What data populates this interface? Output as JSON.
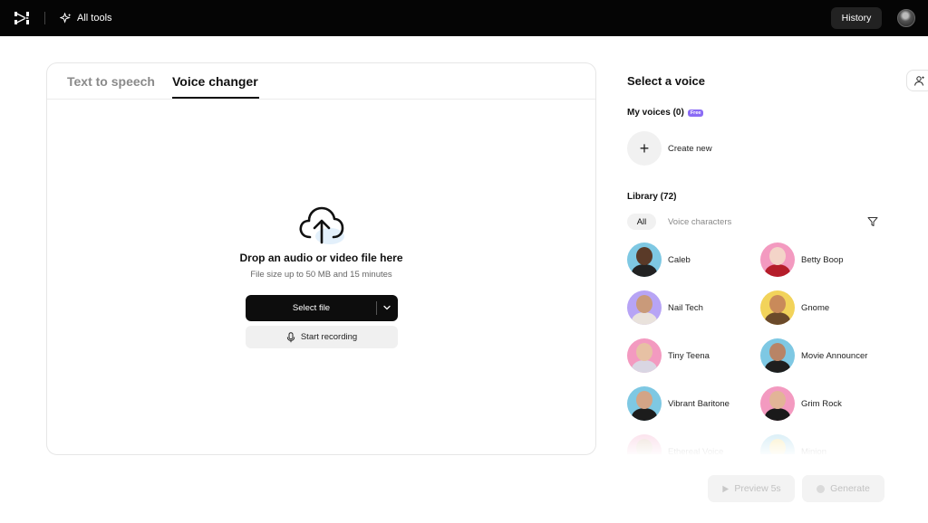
{
  "topbar": {
    "logo_icon": "capcut-logo-icon",
    "all_tools_label": "All tools",
    "all_tools_icon": "sparkle-icon",
    "history_label": "History"
  },
  "tabs": [
    {
      "label": "Text to speech",
      "active": false
    },
    {
      "label": "Voice changer",
      "active": true
    }
  ],
  "upload": {
    "icon": "cloud-upload-icon",
    "title": "Drop an audio or video file here",
    "subtitle": "File size up to 50 MB and 15 minutes",
    "select_label": "Select file",
    "record_label": "Start recording"
  },
  "voices": {
    "title": "Select a voice",
    "my_voices_label": "My voices (0)",
    "free_badge": "Free",
    "create_label": "Create new",
    "library_label": "Library (72)",
    "filter_all": "All",
    "filter_chars": "Voice characters",
    "items": [
      {
        "name": "Caleb",
        "bg": "#7ec8e3",
        "skin": "#5a3a28",
        "shirt": "#222"
      },
      {
        "name": "Betty Boop",
        "bg": "#f39ac0",
        "skin": "#f3d4c8",
        "shirt": "#b51d2a"
      },
      {
        "name": "Nail Tech",
        "bg": "#b7a4f5",
        "skin": "#c99a7a",
        "shirt": "#e9e2dc"
      },
      {
        "name": "Gnome",
        "bg": "#f2d35a",
        "skin": "#c98a5a",
        "shirt": "#6b4a2a"
      },
      {
        "name": "Tiny Teena",
        "bg": "#f39ac0",
        "skin": "#e7c1a4",
        "shirt": "#d9d6e3"
      },
      {
        "name": "Movie Announcer",
        "bg": "#7ec8e3",
        "skin": "#b88466",
        "shirt": "#1e1e1e"
      },
      {
        "name": "Vibrant Baritone",
        "bg": "#7ec8e3",
        "skin": "#d3a486",
        "shirt": "#1c1c1c"
      },
      {
        "name": "Grim Rock",
        "bg": "#f39ac0",
        "skin": "#e2b497",
        "shirt": "#1a1a1a"
      },
      {
        "name": "Ethereal Voice",
        "bg": "#f39ac0",
        "skin": "#caa48a",
        "shirt": "#9a7a6a"
      },
      {
        "name": "Minion",
        "bg": "#7ec8e3",
        "skin": "#f2d35a",
        "shirt": "#3d6fb0"
      }
    ]
  },
  "actions": {
    "preview_label": "Preview 5s",
    "generate_label": "Generate"
  }
}
